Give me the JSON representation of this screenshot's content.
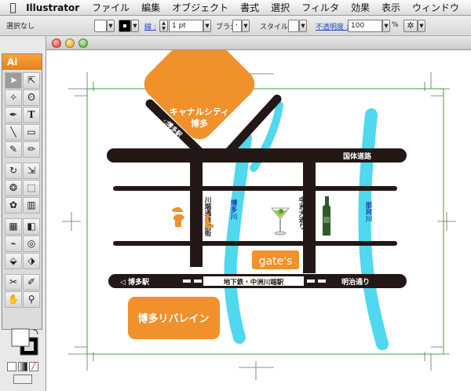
{
  "menubar": {
    "app_name": "Illustrator",
    "items": [
      "ファイル",
      "編集",
      "オブジェクト",
      "書式",
      "選択",
      "フィルタ",
      "効果",
      "表示",
      "ウィンドウ"
    ]
  },
  "control_bar": {
    "selection_status": "選択なし",
    "stroke_label": "線 :",
    "stroke_weight": "1 pt",
    "brush_label": "ブラシ :",
    "brush_value": "･",
    "style_label": "スタイル :",
    "opacity_label": "不透明度 :",
    "opacity_value": "100",
    "opacity_unit": "%"
  },
  "toolbox": {
    "title": "Ai"
  },
  "colors": {
    "accent_orange": "#f0912c",
    "road_black": "#231815",
    "river_cyan": "#4fd8ee",
    "artboard_green": "#2fa836",
    "river_label_blue": "#1f3fb4"
  },
  "map": {
    "canal_city": [
      "キャナルシティ",
      "博多"
    ],
    "hakata_diagonal": "◁博多駅",
    "national_road": "国体道路",
    "kawabata_street": "川端通商店街",
    "hakata_river": "博多川",
    "nakasu_street": "中洲大通り",
    "naka_river": "那珂川",
    "gates": "gate's",
    "hakata_station": "◁ 博多駅",
    "subway_station": "地下鉄・中洲川端駅",
    "meiji_street": "明治通り",
    "riverain": "博多リバレイン"
  }
}
